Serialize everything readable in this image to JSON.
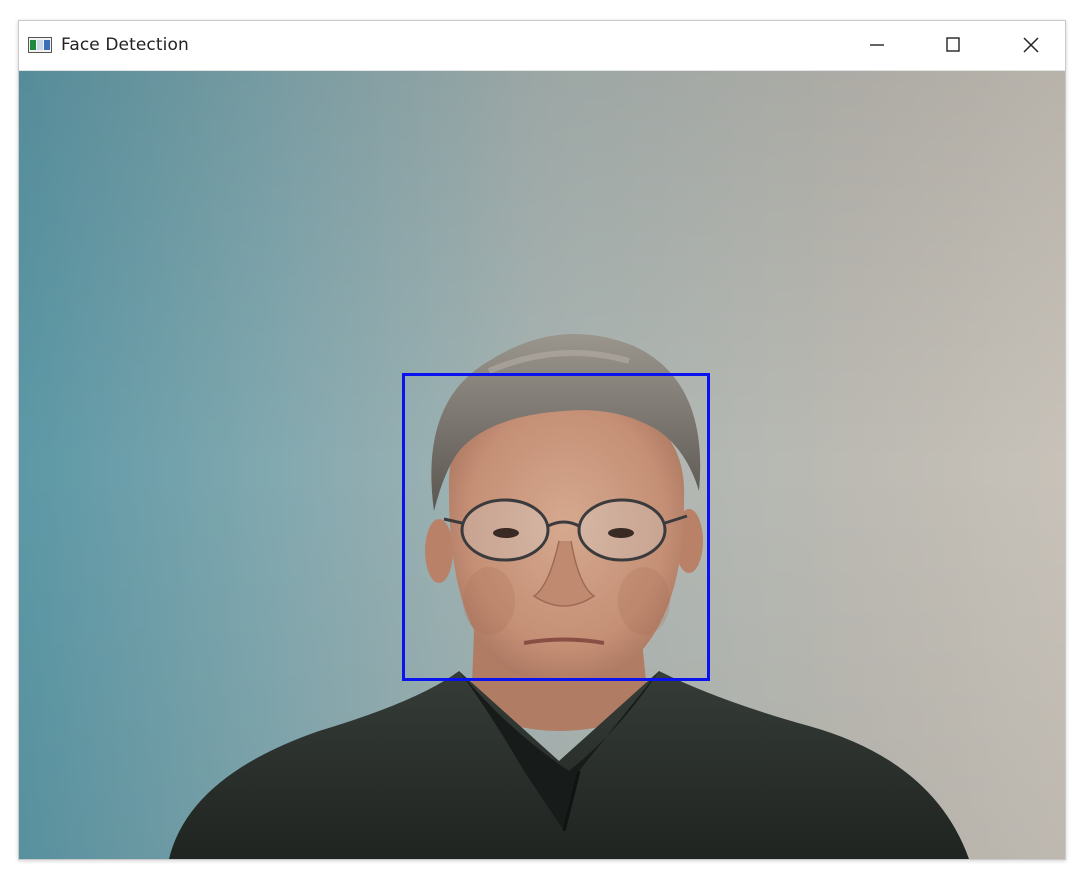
{
  "window": {
    "title": "Face Detection",
    "icon": "opencv-window-icon",
    "controls": {
      "minimize": "minimize-icon",
      "maximize": "maximize-icon",
      "close": "close-icon"
    }
  },
  "colors": {
    "box": "#0a12f0",
    "background_left": "#5f9aa8",
    "background_right": "#c4c0b8",
    "shirt": "#2a2f2c"
  }
}
